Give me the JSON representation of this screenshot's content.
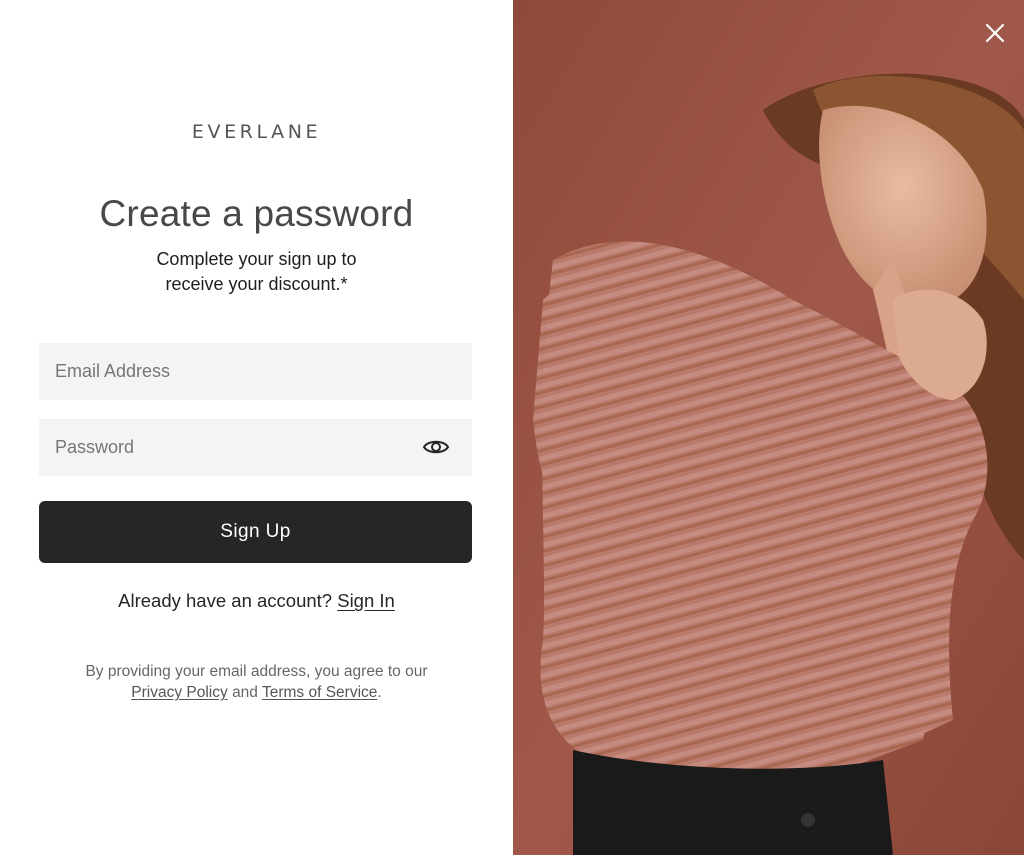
{
  "brand": {
    "logo_text": "EVERLANE"
  },
  "form": {
    "title": "Create a password",
    "subtitle_line1": "Complete your sign up to",
    "subtitle_line2": "receive your discount.*",
    "email_placeholder": "Email Address",
    "password_placeholder": "Password",
    "password_toggle_icon": "eye-icon",
    "submit_label": "Sign Up"
  },
  "account": {
    "prompt": "Already have an account?",
    "sign_in_link": "Sign In"
  },
  "legal": {
    "text": "By providing your email address, you agree to our",
    "privacy_link": "Privacy Policy",
    "conjunction": "and",
    "terms_link": "Terms of Service",
    "period": "."
  },
  "modal": {
    "close_icon": "close-icon"
  },
  "colors": {
    "button_bg": "#262626",
    "field_bg": "#f4f4f3",
    "photo_backdrop": "#9a5240",
    "sweater": "#b87466"
  }
}
